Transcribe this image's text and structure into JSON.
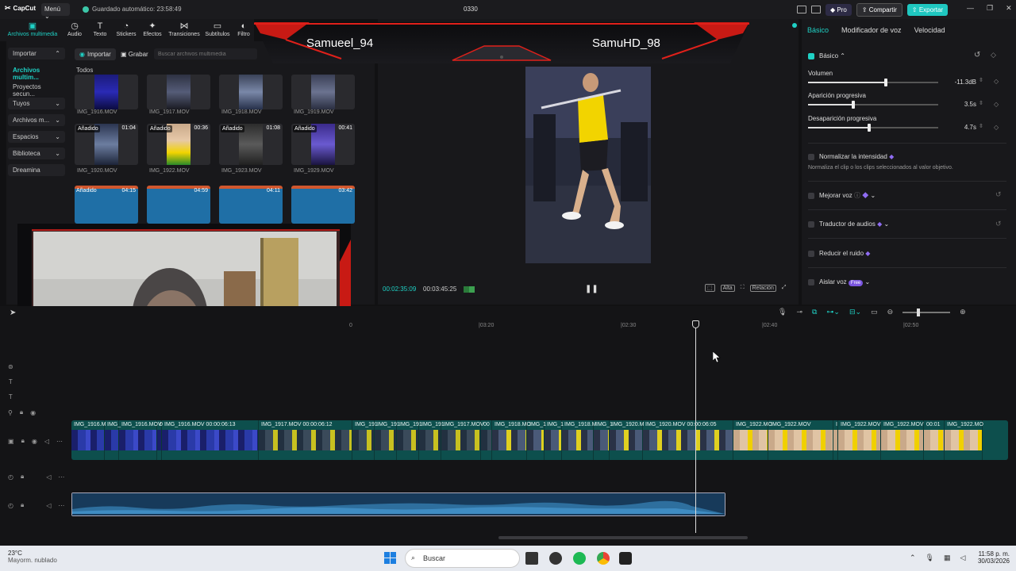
{
  "titlebar": {
    "app_name": "CapCut",
    "menu_label": "Menú",
    "autosave": "Guardado automático: 23:58:49",
    "project_name": "0330",
    "pro_label": "Pro",
    "share_label": "Compartir",
    "export_label": "Exportar",
    "minimize": "—",
    "maximize": "❐",
    "close": "✕"
  },
  "toolbar": {
    "tabs": [
      {
        "label": "Archivos multimedia",
        "icon": "media-icon"
      },
      {
        "label": "Audio",
        "icon": "audio-icon"
      },
      {
        "label": "Texto",
        "icon": "text-icon"
      },
      {
        "label": "Stickers",
        "icon": "sticker-icon"
      },
      {
        "label": "Efectos",
        "icon": "effects-icon"
      },
      {
        "label": "Transiciones",
        "icon": "transitions-icon"
      },
      {
        "label": "Subtítulos",
        "icon": "subtitles-icon"
      },
      {
        "label": "Filtro",
        "icon": "filter-icon"
      }
    ]
  },
  "media": {
    "side_nav": [
      {
        "label": "Importar"
      },
      {
        "label": "Archivos multim..."
      },
      {
        "label": "Proyectos secun..."
      },
      {
        "label": "Tuyos"
      },
      {
        "label": "Archivos m..."
      },
      {
        "label": "Espacios"
      },
      {
        "label": "Biblioteca"
      },
      {
        "label": "Dreamina"
      }
    ],
    "import_tab": "Importar",
    "record_tab": "Grabar",
    "search_placeholder": "Buscar archivos multimedia",
    "all_label": "Todos",
    "row1": [
      {
        "name": "IMG_1916.MOV"
      },
      {
        "name": "IMG_1917.MOV"
      },
      {
        "name": "IMG_1918.MOV"
      },
      {
        "name": "IMG_1919.MOV"
      }
    ],
    "row2": [
      {
        "name": "IMG_1920.MOV",
        "badge": "Añadido",
        "duration": "01:04"
      },
      {
        "name": "IMG_1922.MOV",
        "badge": "Añadido",
        "duration": "00:36"
      },
      {
        "name": "IMG_1923.MOV",
        "badge": "Añadido",
        "duration": "01:08"
      },
      {
        "name": "IMG_1929.MOV",
        "badge": "Añadido",
        "duration": "00:41"
      }
    ],
    "row3": [
      {
        "badge": "Añadido",
        "duration": "04:15"
      },
      {
        "badge": "",
        "duration": "04:59"
      },
      {
        "badge": "",
        "duration": "04:11"
      },
      {
        "badge": "",
        "duration": "03:42"
      }
    ]
  },
  "overlay": {
    "player1": "Samueel_94",
    "player2": "SamuHD_98"
  },
  "preview": {
    "current_time": "00:02:35:09",
    "total_time": "00:03:45:25",
    "pause_icon": "❚❚",
    "ctrl_alta": "Alta",
    "ctrl_ratio": "Relación"
  },
  "inspector": {
    "tabs": [
      "Básico",
      "Modificador de voz",
      "Velocidad"
    ],
    "section": "Básico",
    "volume_label": "Volumen",
    "volume_value": "-11.3dB",
    "volume_level": 0.6,
    "fadein_label": "Aparición progresiva",
    "fadein_value": "3.5s",
    "fadein_level": 0.35,
    "fadeout_label": "Desaparición progresiva",
    "fadeout_value": "4.7s",
    "fadeout_level": 0.47,
    "normalize_label": "Normalizar la intensidad",
    "normalize_desc": "Normaliza el clip o los clips seleccionados al valor objetivo.",
    "enhance_label": "Mejorar voz",
    "translate_label": "Traductor de audios",
    "reduce_label": "Reducir el ruido",
    "isolate_label": "Aislar voz",
    "free_badge": "Free"
  },
  "timeline": {
    "ruler": [
      "0",
      "|03:20",
      "|02:30",
      "|02:40",
      "|02:50"
    ],
    "clips": [
      {
        "label": "IMG_1916.M",
        "w": 42
      },
      {
        "label": "IMG_",
        "w": 18
      },
      {
        "label": "IMG_1916.MOV",
        "w": 48
      },
      {
        "label": "0",
        "w": 6
      },
      {
        "label": "IMG_1916.MOV   00:00:06:13",
        "w": 122
      },
      {
        "label": "IMG_1917.MOV   00:00:06:12",
        "w": 118
      },
      {
        "label": "IMG_191",
        "w": 28
      },
      {
        "label": "IMG_191",
        "w": 28
      },
      {
        "label": "IMG_191",
        "w": 28
      },
      {
        "label": "IMG_191",
        "w": 28
      },
      {
        "label": "IMG_1917.MOV",
        "w": 50
      },
      {
        "label": "00",
        "w": 14
      },
      {
        "label": "IMG_1918.MO",
        "w": 44
      },
      {
        "label": "IMG_1",
        "w": 22
      },
      {
        "label": "IMG_1",
        "w": 22
      },
      {
        "label": "IMG_1918.M",
        "w": 40
      },
      {
        "label": "IMG_1",
        "w": 20
      },
      {
        "label": "IMG_1920.M",
        "w": 42
      },
      {
        "label": "IMG_1920.MOV   00:00:06:05",
        "w": 114
      },
      {
        "label": "IMG_1922.MO",
        "w": 44
      },
      {
        "label": "IMG_1922.MOV",
        "w": 82
      },
      {
        "label": "I",
        "w": 6
      },
      {
        "label": "IMG_1922.MOV",
        "w": 54
      },
      {
        "label": "IMG_1922.MOV",
        "w": 54
      },
      {
        "label": "00:01",
        "w": 26
      },
      {
        "label": "IMG_1922.MO",
        "w": 48
      }
    ]
  },
  "taskbar": {
    "temp": "23°C",
    "weather": "Mayorm. nublado",
    "search": "Buscar",
    "time": "11:58 p. m.",
    "date": "30/03/2026"
  },
  "colors": {
    "accent": "#1fd1c5",
    "export": "#1fc7c0",
    "banner_red": "#e0201a",
    "video_track": "#0d4f4d",
    "audio_track": "#173a5a"
  }
}
